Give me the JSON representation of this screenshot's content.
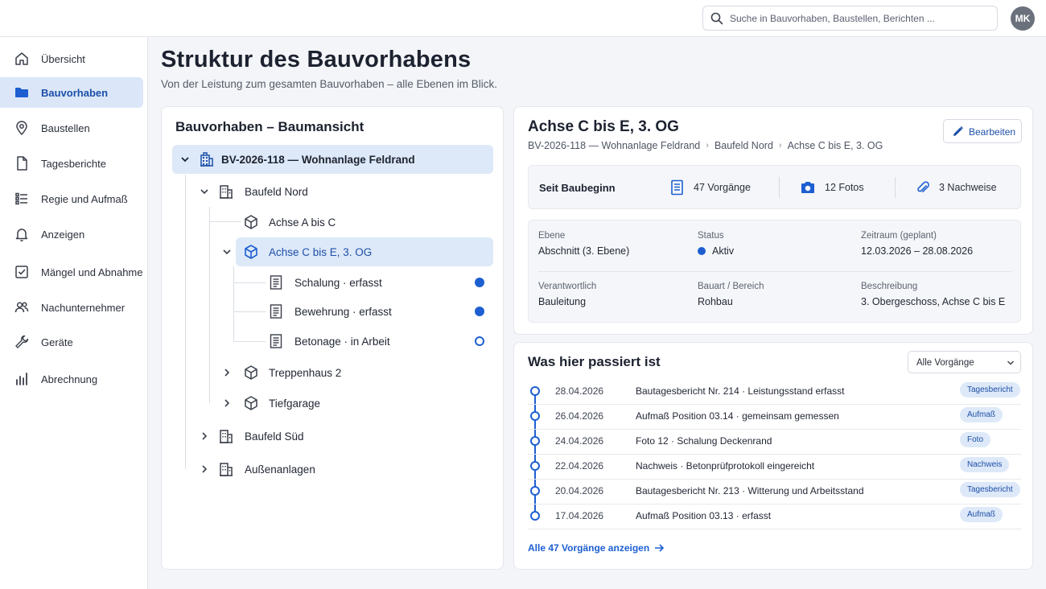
{
  "search": {
    "placeholder": "Suche in Bauvorhaben, Baustellen, Berichten ..."
  },
  "user": {
    "initials": "MK"
  },
  "sidebar": {
    "items": [
      {
        "label": "Übersicht",
        "icon": "home-icon"
      },
      {
        "label": "Bauvorhaben",
        "icon": "folder-icon",
        "active": true
      },
      {
        "label": "Baustellen",
        "icon": "map-pin-icon"
      },
      {
        "label": "Tagesberichte",
        "icon": "document-icon"
      },
      {
        "label": "Regie und Aufmaß",
        "icon": "list-icon"
      },
      {
        "label": "Anzeigen",
        "icon": "bell-icon"
      },
      {
        "label": "Mängel und Abnahme",
        "icon": "checkbox-icon"
      },
      {
        "label": "Nachunternehmer",
        "icon": "users-icon"
      },
      {
        "label": "Geräte",
        "icon": "wrench-icon"
      },
      {
        "label": "Abrechnung",
        "icon": "bar-chart-icon"
      }
    ]
  },
  "header": {
    "title": "Struktur des Bauvorhabens",
    "subtitle": "Von der Leistung zum gesamten Bauvorhaben – alle Ebenen im Blick."
  },
  "tree": {
    "title": "Bauvorhaben – Baumansicht",
    "root": "BV-2026-118 — Wohnanlage Feldrand",
    "baufeld_nord": "Baufeld Nord",
    "achse_ab": "Achse A bis C",
    "achse_ce": "Achse C bis E, 3. OG",
    "leaf_1": "Schalung · erfasst",
    "leaf_2": "Bewehrung · erfasst",
    "leaf_3": "Betonage · in Arbeit",
    "treppenhaus": "Treppenhaus 2",
    "tiefgarage": "Tiefgarage",
    "baufeld_sued": "Baufeld Süd",
    "aussenanlagen": "Außenanlagen"
  },
  "detail": {
    "title": "Achse C bis E, 3. OG",
    "breadcrumb": [
      "BV-2026-118 — Wohnanlage Feldrand",
      "Baufeld Nord",
      "Achse C bis E, 3. OG"
    ],
    "edit_label": "Bearbeiten",
    "stats_title": "Seit Baubeginn",
    "stats": {
      "vorgaenge": "47 Vorgänge",
      "fotos": "12 Fotos",
      "nachweise": "3 Nachweise"
    },
    "fields": {
      "ebene_label": "Ebene",
      "ebene_value": "Abschnitt (3. Ebene)",
      "status_label": "Status",
      "status_value": "Aktiv",
      "zeitraum_label": "Zeitraum (geplant)",
      "zeitraum_value": "12.03.2026 – 28.08.2026",
      "verantwortlich_label": "Verantwortlich",
      "verantwortlich_value": "Bauleitung",
      "bauart_label": "Bauart / Bereich",
      "bauart_value": "Rohbau",
      "beschreibung_label": "Beschreibung",
      "beschreibung_value": "3. Obergeschoss, Achse C bis E"
    }
  },
  "activity": {
    "title": "Was hier passiert ist",
    "filter": "Alle Vorgänge",
    "rows": [
      {
        "date": "28.04.2026",
        "text": "Bautagesbericht Nr. 214 · Leistungsstand erfasst",
        "tag": "Tagesbericht"
      },
      {
        "date": "26.04.2026",
        "text": "Aufmaß Position 03.14 · gemeinsam gemessen",
        "tag": "Aufmaß"
      },
      {
        "date": "24.04.2026",
        "text": "Foto 12 · Schalung Deckenrand",
        "tag": "Foto"
      },
      {
        "date": "22.04.2026",
        "text": "Nachweis · Betonprüfprotokoll eingereicht",
        "tag": "Nachweis"
      },
      {
        "date": "20.04.2026",
        "text": "Bautagesbericht Nr. 213 · Witterung und Arbeitsstand",
        "tag": "Tagesbericht"
      },
      {
        "date": "17.04.2026",
        "text": "Aufmaß Position 03.13 · erfasst",
        "tag": "Aufmaß"
      }
    ],
    "all_link": "Alle 47 Vorgänge anzeigen"
  },
  "colors": {
    "accent": "#1d5fd1",
    "active_bg": "#dbe7f8",
    "page_bg": "#f3f5f8"
  }
}
